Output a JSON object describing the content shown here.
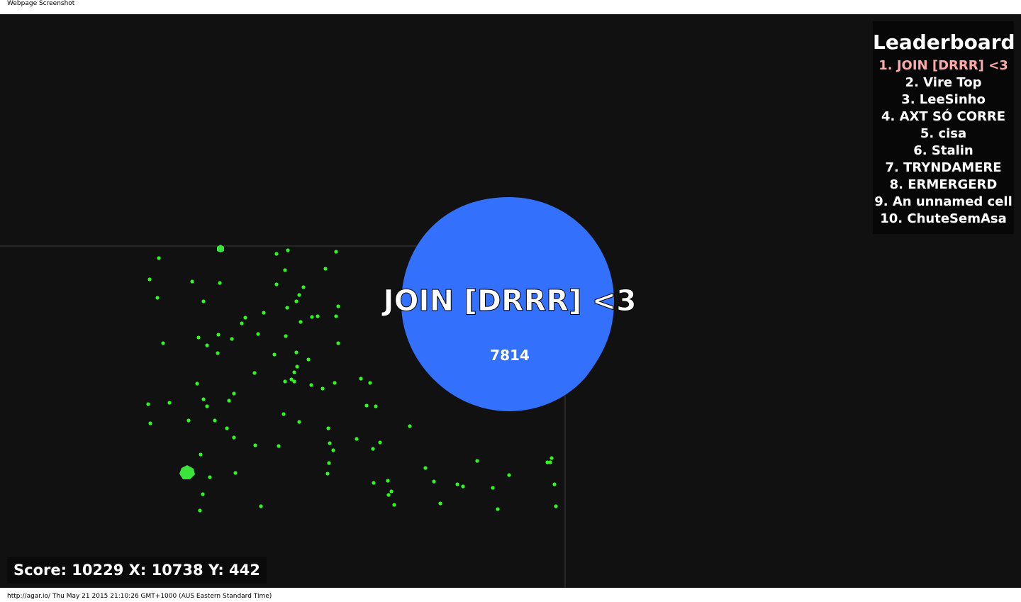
{
  "window": {
    "title": "Webpage Screenshot",
    "footer": "http://agar.io/ Thu May 21 2015 21:10:26 GMT+1000 (AUS Eastern Standard Time)"
  },
  "colors": {
    "background": "#111111",
    "grid": "#333333",
    "player_cell": "#3370fb",
    "food": "#2ef81e",
    "virus": "#3be43b",
    "leaderboard_self": "#ffaaaa"
  },
  "player": {
    "name": "JOIN [DRRR] <3",
    "mass": "7814"
  },
  "score_line": "Score: 10229 X: 10738 Y: 442",
  "leaderboard": {
    "title": "Leaderboard",
    "items": [
      "1. JOIN [DRRR] <3",
      "2. Vire Top",
      "3. LeeSinho",
      "4. AXT SÓ CORRE",
      "5. cisa",
      "6. Stalin",
      "7. TRYNDAMERE",
      "8. ERMERGERD",
      "9. An unnamed cell",
      "10. ChuteSemAsa"
    ]
  }
}
